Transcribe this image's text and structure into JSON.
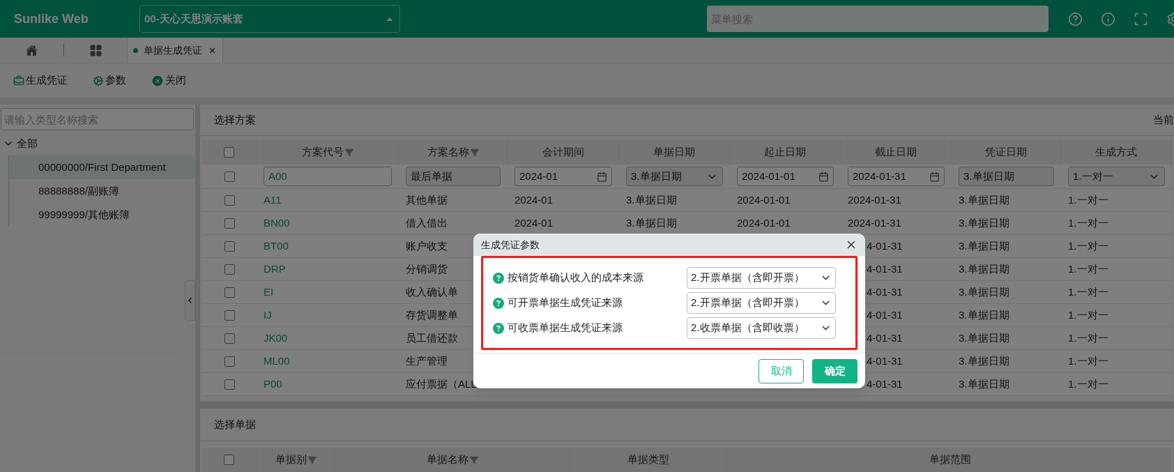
{
  "header": {
    "logo": "Sunlike Web",
    "account": "00-天心天思演示账套",
    "search": {
      "placeholder": "菜单搜索"
    }
  },
  "tabs": [
    {
      "label": "单据生成凭证",
      "selected": true
    }
  ],
  "toolbar": [
    {
      "kind": "voucher",
      "label": "生成凭证"
    },
    {
      "kind": "params",
      "label": "参数"
    },
    {
      "kind": "close",
      "label": "关闭"
    }
  ],
  "sidebar": {
    "search": {
      "placeholder": "请输入类型名称搜索"
    },
    "tree": [
      {
        "label": "全部",
        "expanded": true,
        "children": [
          {
            "label": "00000000/First Department",
            "selected": true
          },
          {
            "label": "88888888/副账簿",
            "selected": false
          },
          {
            "label": "99999999/其他账簿",
            "selected": false
          }
        ]
      }
    ]
  },
  "scheme_panel": {
    "title": "选择方案",
    "right_label": "当前",
    "header_checked": false,
    "columns": [
      {
        "label": "方案代号",
        "filter": true
      },
      {
        "label": "方案名称",
        "filter": true
      },
      {
        "label": "会计期间",
        "filter": false
      },
      {
        "label": "单据日期",
        "filter": false
      },
      {
        "label": "起止日期",
        "filter": false
      },
      {
        "label": "截止日期",
        "filter": false
      },
      {
        "label": "凭证日期",
        "filter": false
      },
      {
        "label": "生成方式",
        "filter": false
      }
    ],
    "filter_row": {
      "checked": false,
      "cells": [
        {
          "kind": "text",
          "value": "A00"
        },
        {
          "kind": "readonly",
          "value": "最后单据"
        },
        {
          "kind": "date",
          "value": "2024-01"
        },
        {
          "kind": "select",
          "value": "3.单据日期"
        },
        {
          "kind": "date",
          "value": "2024-01-01"
        },
        {
          "kind": "date",
          "value": "2024-01-31"
        },
        {
          "kind": "readonly",
          "value": "3.单据日期"
        },
        {
          "kind": "select",
          "value": "1.一对一"
        }
      ]
    },
    "rows": [
      {
        "checked": false,
        "cells": [
          "A11",
          "其他单据",
          "2024-01",
          "3.单据日期",
          "2024-01-01",
          "2024-01-31",
          "3.单据日期",
          "1.一对一"
        ]
      },
      {
        "checked": false,
        "cells": [
          "BN00",
          "借入借出",
          "2024-01",
          "3.单据日期",
          "2024-01-01",
          "2024-01-31",
          "3.单据日期",
          "1.一对一"
        ]
      },
      {
        "checked": false,
        "cells": [
          "BT00",
          "账户收支",
          null,
          null,
          null,
          {
            "kind": "partial",
            "value": "4-01-31"
          },
          "3.单据日期",
          "1.一对一"
        ]
      },
      {
        "checked": false,
        "cells": [
          "DRP",
          "分销调货",
          null,
          null,
          null,
          {
            "kind": "partial",
            "value": "4-01-31"
          },
          "3.单据日期",
          "1.一对一"
        ]
      },
      {
        "checked": false,
        "cells": [
          "EI",
          "收入确认单",
          null,
          null,
          null,
          {
            "kind": "partial",
            "value": "4-01-31"
          },
          "3.单据日期",
          "1.一对一"
        ]
      },
      {
        "checked": false,
        "cells": [
          "IJ",
          "存货调整单",
          null,
          null,
          null,
          {
            "kind": "partial",
            "value": "4-01-31"
          },
          "3.单据日期",
          "1.一对一"
        ]
      },
      {
        "checked": false,
        "cells": [
          "JK00",
          "员工借还款",
          null,
          null,
          null,
          {
            "kind": "partial",
            "value": "4-01-31"
          },
          "3.单据日期",
          "1.一对一"
        ]
      },
      {
        "checked": false,
        "cells": [
          "ML00",
          "生产管理",
          null,
          null,
          null,
          {
            "kind": "partial",
            "value": "4-01-31"
          },
          "3.单据日期",
          "1.一对一"
        ]
      },
      {
        "checked": false,
        "cells": [
          "P00",
          "应付票据（ALL",
          null,
          null,
          null,
          {
            "kind": "partial",
            "value": "4-01-31"
          },
          "3.单据日期",
          "1.一对一"
        ]
      }
    ]
  },
  "document_panel": {
    "title": "选择单据",
    "header_checked": false,
    "columns": [
      {
        "label": "单据别",
        "filter": true
      },
      {
        "label": "单据名称",
        "filter": true
      },
      {
        "label": "单据类型",
        "filter": false
      },
      {
        "label": "单据范围",
        "filter": false
      }
    ]
  },
  "dialog": {
    "title": "生成凭证参数",
    "params": [
      {
        "label": "按销货单确认收入的成本来源",
        "value": "2.开票单据（含即开票）"
      },
      {
        "label": "可开票单据生成凭证来源",
        "value": "2.开票单据（含即开票）"
      },
      {
        "label": "可收票单据生成凭证来源",
        "value": "2.收票单据（含即收票）"
      }
    ],
    "buttons": [
      {
        "kind": "secondary",
        "label": "取消"
      },
      {
        "kind": "primary",
        "label": "确定"
      }
    ]
  }
}
